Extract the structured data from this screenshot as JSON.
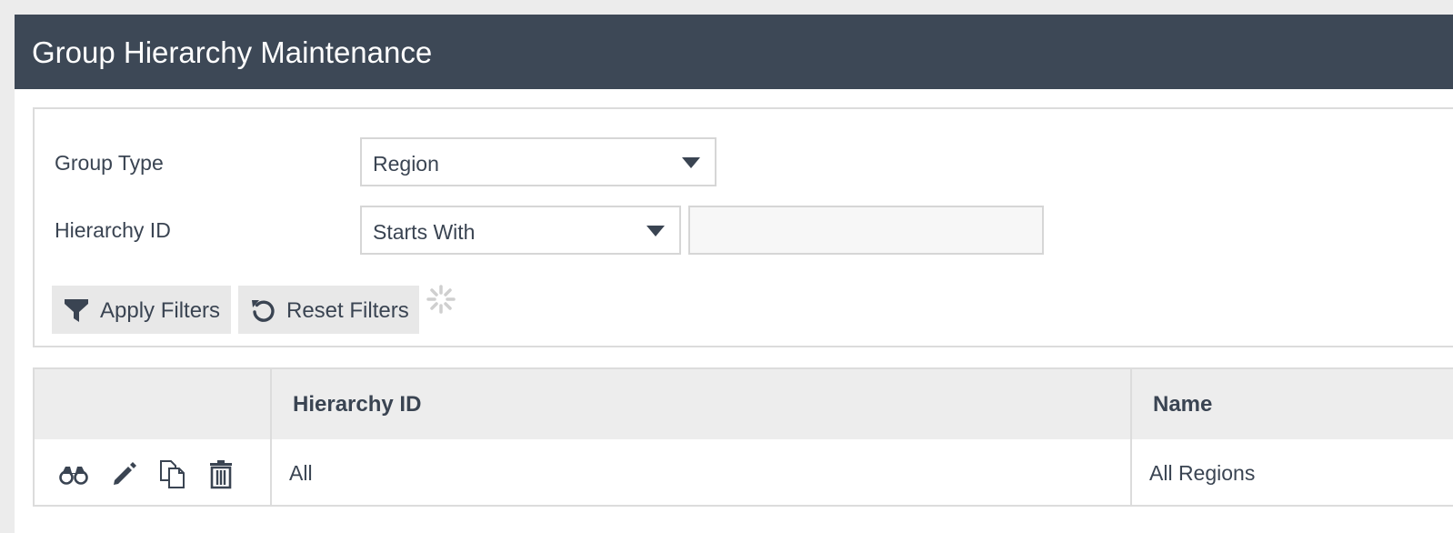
{
  "header": {
    "title": "Group Hierarchy Maintenance"
  },
  "filters": {
    "group_type": {
      "label": "Group Type",
      "selected": "Region"
    },
    "hierarchy_id": {
      "label": "Hierarchy ID",
      "operator": "Starts With",
      "value": ""
    },
    "apply_label": "Apply Filters",
    "reset_label": "Reset Filters"
  },
  "grid": {
    "columns": [
      "",
      "Hierarchy ID",
      "Name"
    ],
    "rows": [
      {
        "hierarchy_id": "All",
        "name": "All Regions",
        "actions": [
          "binoculars-icon",
          "pencil-icon",
          "copy-icon",
          "trash-icon"
        ]
      }
    ]
  },
  "colors": {
    "header_bg": "#3d4856",
    "text": "#3a4452",
    "button_bg": "#e8e8e8",
    "grid_header_bg": "#ededed"
  }
}
